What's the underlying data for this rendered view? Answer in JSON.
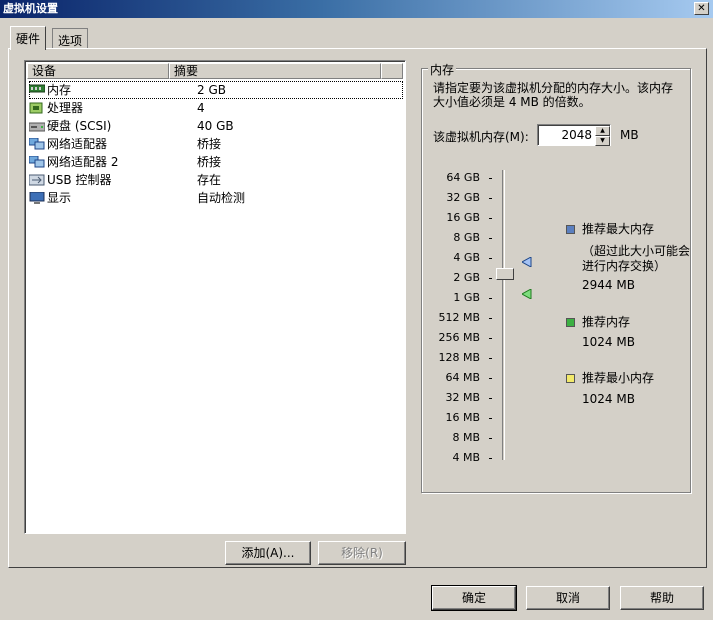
{
  "window": {
    "title": "虚拟机设置",
    "close_glyph": "✕"
  },
  "tabs": [
    {
      "label": "硬件",
      "active": true
    },
    {
      "label": "选项",
      "active": false
    }
  ],
  "device_list": {
    "columns": [
      "设备",
      "摘要"
    ],
    "rows": [
      {
        "name": "内存",
        "summary": "2 GB",
        "icon": "memory-icon",
        "selected": true
      },
      {
        "name": "处理器",
        "summary": "4",
        "icon": "processor-icon"
      },
      {
        "name": "硬盘 (SCSI)",
        "summary": "40 GB",
        "icon": "hard-disk-icon"
      },
      {
        "name": "网络适配器",
        "summary": "桥接",
        "icon": "network-adapter-icon"
      },
      {
        "name": "网络适配器 2",
        "summary": "桥接",
        "icon": "network-adapter-icon"
      },
      {
        "name": "USB 控制器",
        "summary": "存在",
        "icon": "usb-icon"
      },
      {
        "name": "显示",
        "summary": "自动检测",
        "icon": "display-icon"
      }
    ],
    "add_button": "添加(A)...",
    "remove_button": "移除(R)"
  },
  "memory_panel": {
    "group_title": "内存",
    "description": "请指定要为该虚拟机分配的内存大小。该内存大小值必须是 4 MB 的倍数。",
    "field_label": "该虚拟机内存(M):",
    "field_value": "2048",
    "unit": "MB",
    "scale_labels": [
      "64 GB",
      "32 GB",
      "16 GB",
      "8 GB",
      "4 GB",
      "2 GB",
      "1 GB",
      "512 MB",
      "256 MB",
      "128 MB",
      "64 MB",
      "32 MB",
      "16 MB",
      "8 MB",
      "4 MB"
    ],
    "slider_value_label": "2 GB",
    "legend": [
      {
        "label": "推荐最大内存",
        "note": "（超过此大小可能会进行内存交换）",
        "value": "2944 MB",
        "color": "#5b7fbf"
      },
      {
        "label": "推荐内存",
        "note": "",
        "value": "1024 MB",
        "color": "#3cb043"
      },
      {
        "label": "推荐最小内存",
        "note": "",
        "value": "1024 MB",
        "color": "#f2e96a"
      }
    ]
  },
  "footer": {
    "ok": "确定",
    "cancel": "取消",
    "help": "帮助"
  }
}
